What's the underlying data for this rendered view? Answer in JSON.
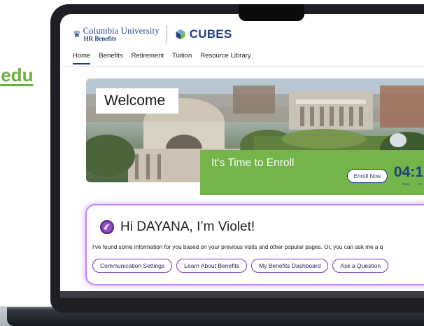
{
  "background": {
    "link_fragment": ".edu"
  },
  "header": {
    "university_name": "Columbia University",
    "university_sub": "HR Benefits",
    "app_name": "CUBES"
  },
  "nav": {
    "items": [
      {
        "label": "Home",
        "active": true
      },
      {
        "label": "Benefits"
      },
      {
        "label": "Retirement"
      },
      {
        "label": "Tuition"
      },
      {
        "label": "Resource Library"
      }
    ]
  },
  "hero": {
    "welcome": "Welcome",
    "enroll_title": "It's Time to Enroll",
    "enroll_button": "Enroll Now",
    "countdown": "04:1",
    "days_label": "Days",
    "hours_label": "Ho"
  },
  "violet": {
    "greeting": "Hi DAYANA, I’m Violet!",
    "message": "I've found some information for you based on your previous visits and other popular pages. Or, you can ask me a q",
    "chips": [
      "Communication Settings",
      "Learn About Benefits",
      "My Benefits Dashboard",
      "Ask a Question"
    ]
  },
  "colors": {
    "brand_blue": "#1f3f7f",
    "enroll_green": "#73b548",
    "violet_accent": "#c084fc",
    "link_green": "#6bb13c"
  }
}
